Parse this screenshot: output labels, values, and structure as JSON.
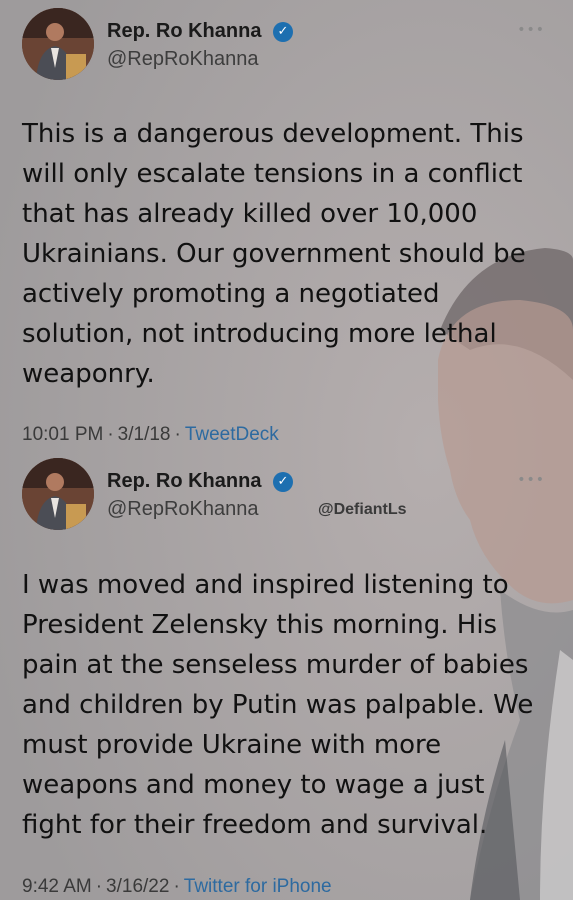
{
  "tweets": [
    {
      "display_name": "Rep. Ro Khanna",
      "handle": "@RepRoKhanna",
      "text": "This is a dangerous development. This will only escalate tensions in a conflict that has already killed over 10,000 Ukrainians. Our government should be actively promoting a negotiated solution, not introducing more lethal weaponry.",
      "time": "10:01 PM",
      "date": "3/1/18",
      "source": "TweetDeck"
    },
    {
      "display_name": "Rep. Ro Khanna",
      "handle": "@RepRoKhanna",
      "watermark": "@DefiantLs",
      "text": "I was moved and inspired listening to President Zelensky this morning. His pain at the senseless murder of babies and children by Putin was palpable. We must provide Ukraine with more weapons and money to wage a just fight for their freedom and survival.",
      "time": "9:42 AM",
      "date": "3/16/22",
      "source": "Twitter for iPhone"
    }
  ],
  "separator": "·",
  "icons": {
    "verified": "verified-badge-icon",
    "more": "more-options-icon"
  },
  "colors": {
    "link": "#2d6aa0",
    "verified": "#1d6fb0"
  }
}
